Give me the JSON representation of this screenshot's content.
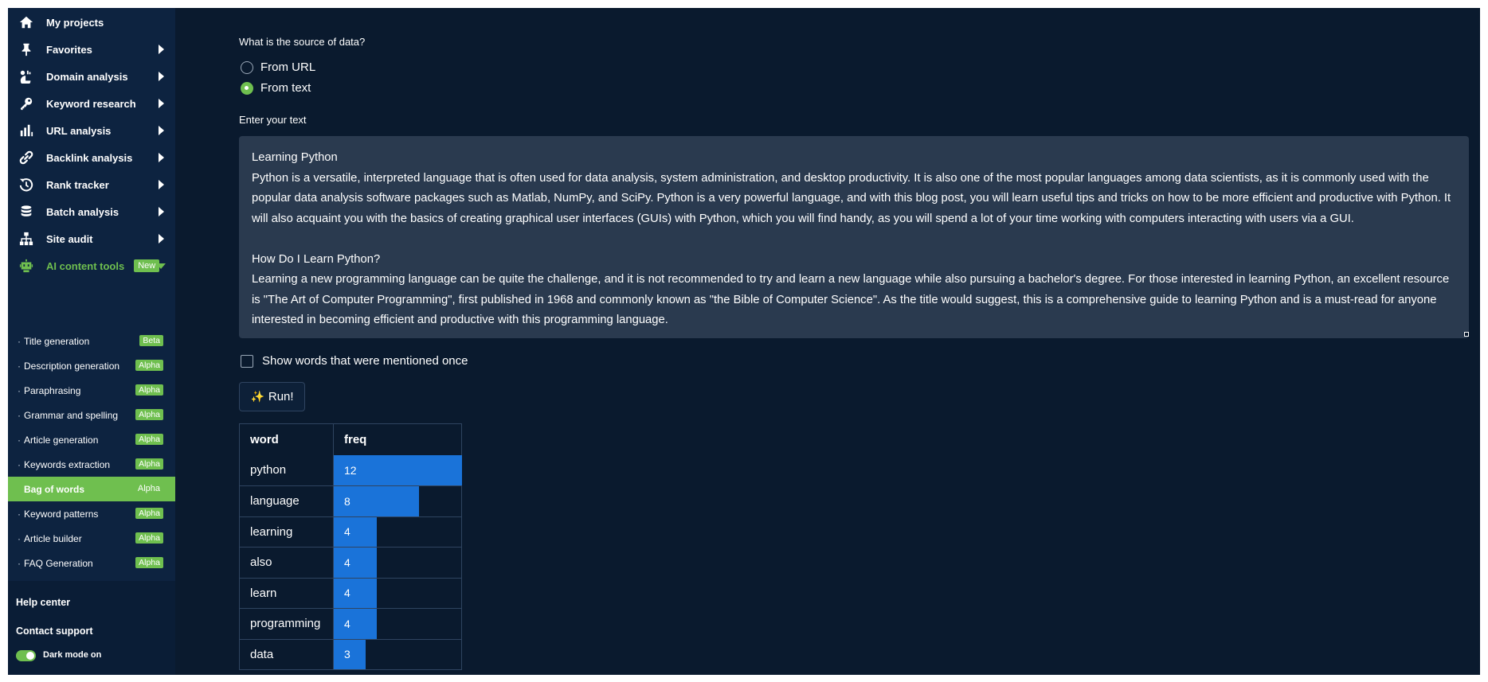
{
  "sidebar": {
    "nav": [
      {
        "label": "My projects",
        "icon": "home-icon",
        "has_caret": false
      },
      {
        "label": "Favorites",
        "icon": "pin-icon",
        "has_caret": true
      },
      {
        "label": "Domain analysis",
        "icon": "chart-pie-icon",
        "has_caret": true
      },
      {
        "label": "Keyword research",
        "icon": "key-icon",
        "has_caret": true
      },
      {
        "label": "URL analysis",
        "icon": "bar-chart-icon",
        "has_caret": true
      },
      {
        "label": "Backlink analysis",
        "icon": "link-icon",
        "has_caret": true
      },
      {
        "label": "Rank tracker",
        "icon": "history-icon",
        "has_caret": true
      },
      {
        "label": "Batch analysis",
        "icon": "database-icon",
        "has_caret": true
      },
      {
        "label": "Site audit",
        "icon": "sitemap-icon",
        "has_caret": true
      },
      {
        "label": "AI content tools",
        "icon": "robot-icon",
        "badge": "New",
        "expanded": true
      }
    ],
    "sub_items": [
      {
        "label": "Title generation",
        "badge": "Beta"
      },
      {
        "label": "Description generation",
        "badge": "Alpha"
      },
      {
        "label": "Paraphrasing",
        "badge": "Alpha"
      },
      {
        "label": "Grammar and spelling",
        "badge": "Alpha"
      },
      {
        "label": "Article generation",
        "badge": "Alpha"
      },
      {
        "label": "Keywords extraction",
        "badge": "Alpha"
      },
      {
        "label": "Bag of words",
        "badge": "Alpha",
        "active": true
      },
      {
        "label": "Keyword patterns",
        "badge": "Alpha"
      },
      {
        "label": "Article builder",
        "badge": "Alpha"
      },
      {
        "label": "FAQ Generation",
        "badge": "Alpha"
      }
    ],
    "help_center": "Help center",
    "contact_support": "Contact support",
    "dark_mode_label": "Dark mode on",
    "dark_mode_on": true
  },
  "form": {
    "source_question": "What is the source of data?",
    "source_options": [
      {
        "label": "From URL",
        "checked": false
      },
      {
        "label": "From text",
        "checked": true
      }
    ],
    "text_label": "Enter your text",
    "text_value": "Learning Python\nPython is a versatile, interpreted language that is often used for data analysis, system administration, and desktop productivity. It is also one of the most popular languages among data scientists, as it is commonly used with the popular data analysis software packages such as Matlab, NumPy, and SciPy. Python is a very powerful language, and with this blog post, you will learn useful tips and tricks on how to be more efficient and productive with Python. It will also acquaint you with the basics of creating graphical user interfaces (GUIs) with Python, which you will find handy, as you will spend a lot of your time working with computers interacting with users via a GUI.\n\nHow Do I Learn Python?\nLearning a new programming language can be quite the challenge, and it is not recommended to try and learn a new language while also pursuing a bachelor's degree. For those interested in learning Python, an excellent resource is \"The Art of Computer Programming\", first published in 1968 and commonly known as \"the Bible of Computer Science\". As the title would suggest, this is a comprehensive guide to learning Python and is a must-read for anyone interested in becoming efficient and productive with this programming language.",
    "show_once_label": "Show words that were mentioned once",
    "show_once_checked": false,
    "run_label": "Run!",
    "run_icon": "sparkles-icon"
  },
  "results": {
    "headers": {
      "word": "word",
      "freq": "freq"
    },
    "max_freq": 12,
    "rows": [
      {
        "word": "python",
        "freq": "12"
      },
      {
        "word": "language",
        "freq": "8"
      },
      {
        "word": "learning",
        "freq": "4"
      },
      {
        "word": "also",
        "freq": "4"
      },
      {
        "word": "learn",
        "freq": "4"
      },
      {
        "word": "programming",
        "freq": "4"
      },
      {
        "word": "data",
        "freq": "3"
      }
    ]
  },
  "colors": {
    "background": "#0a1a2e",
    "sidebar": "#0d2340",
    "accent_green": "#6fbf4f",
    "bar_blue": "#1a73d9"
  }
}
